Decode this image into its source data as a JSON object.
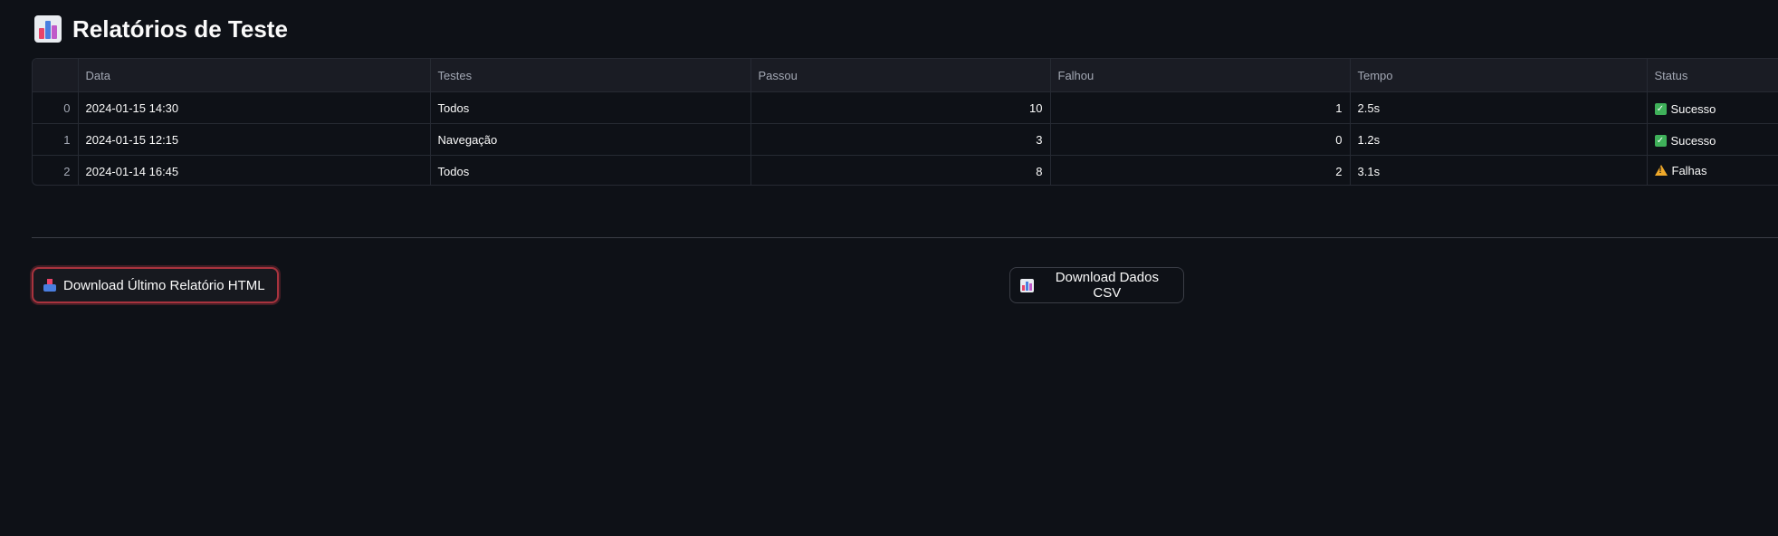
{
  "page": {
    "title": "Relatórios de Teste",
    "title_icon": "bar-chart-icon"
  },
  "table": {
    "columns": [
      "",
      "Data",
      "Testes",
      "Passou",
      "Falhou",
      "Tempo",
      "Status"
    ],
    "rows": [
      {
        "index": "0",
        "data": "2024-01-15 14:30",
        "testes": "Todos",
        "passou": "10",
        "falhou": "1",
        "tempo": "2.5s",
        "status": "Sucesso",
        "status_icon": "check-icon"
      },
      {
        "index": "1",
        "data": "2024-01-15 12:15",
        "testes": "Navegação",
        "passou": "3",
        "falhou": "0",
        "tempo": "1.2s",
        "status": "Sucesso",
        "status_icon": "check-icon"
      },
      {
        "index": "2",
        "data": "2024-01-14 16:45",
        "testes": "Todos",
        "passou": "8",
        "falhou": "2",
        "tempo": "3.1s",
        "status": "Falhas",
        "status_icon": "warning-icon"
      }
    ]
  },
  "buttons": {
    "download_html": "Download Último Relatório HTML",
    "download_csv": "Download Dados CSV"
  },
  "colors": {
    "background": "#0e1117",
    "success": "#3fb15a",
    "warning": "#f0a92a",
    "focus_border": "#a8333e"
  }
}
